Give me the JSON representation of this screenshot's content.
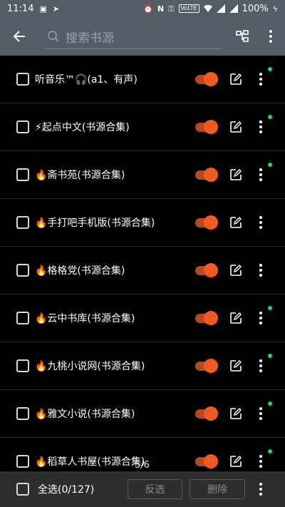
{
  "status_bar": {
    "time": "11:14",
    "battery": "100%"
  },
  "app_bar": {
    "search_placeholder": "搜索书源"
  },
  "sources": [
    {
      "label": "听音乐™🎧(a1、有声)",
      "enabled": true,
      "has_update_dot": true
    },
    {
      "label": "⚡起点中文(书源合集)",
      "enabled": true,
      "has_update_dot": true
    },
    {
      "label": "🔥斋书苑(书源合集)",
      "enabled": true,
      "has_update_dot": true
    },
    {
      "label": "🔥手打吧手机版(书源合集)",
      "enabled": true,
      "has_update_dot": false
    },
    {
      "label": "🔥格格党(书源合集)",
      "enabled": true,
      "has_update_dot": false
    },
    {
      "label": "🔥云中书库(书源合集)",
      "enabled": true,
      "has_update_dot": true
    },
    {
      "label": "🔥九桃小说网(书源合集)",
      "enabled": true,
      "has_update_dot": true
    },
    {
      "label": "🔥雅文小说(书源合集)",
      "enabled": true,
      "has_update_dot": true
    },
    {
      "label": "🔥稻草人书屋(书源合集)",
      "enabled": true,
      "has_update_dot": true
    }
  ],
  "pager": "5/6",
  "bottom_bar": {
    "select_all_label": "全选(0/127)",
    "invert_label": "反选",
    "delete_label": "删除"
  },
  "colors": {
    "toolbar": "#545c66",
    "toggle_on": "#f15a22",
    "update_dot": "#22dd44",
    "background": "#000000"
  }
}
